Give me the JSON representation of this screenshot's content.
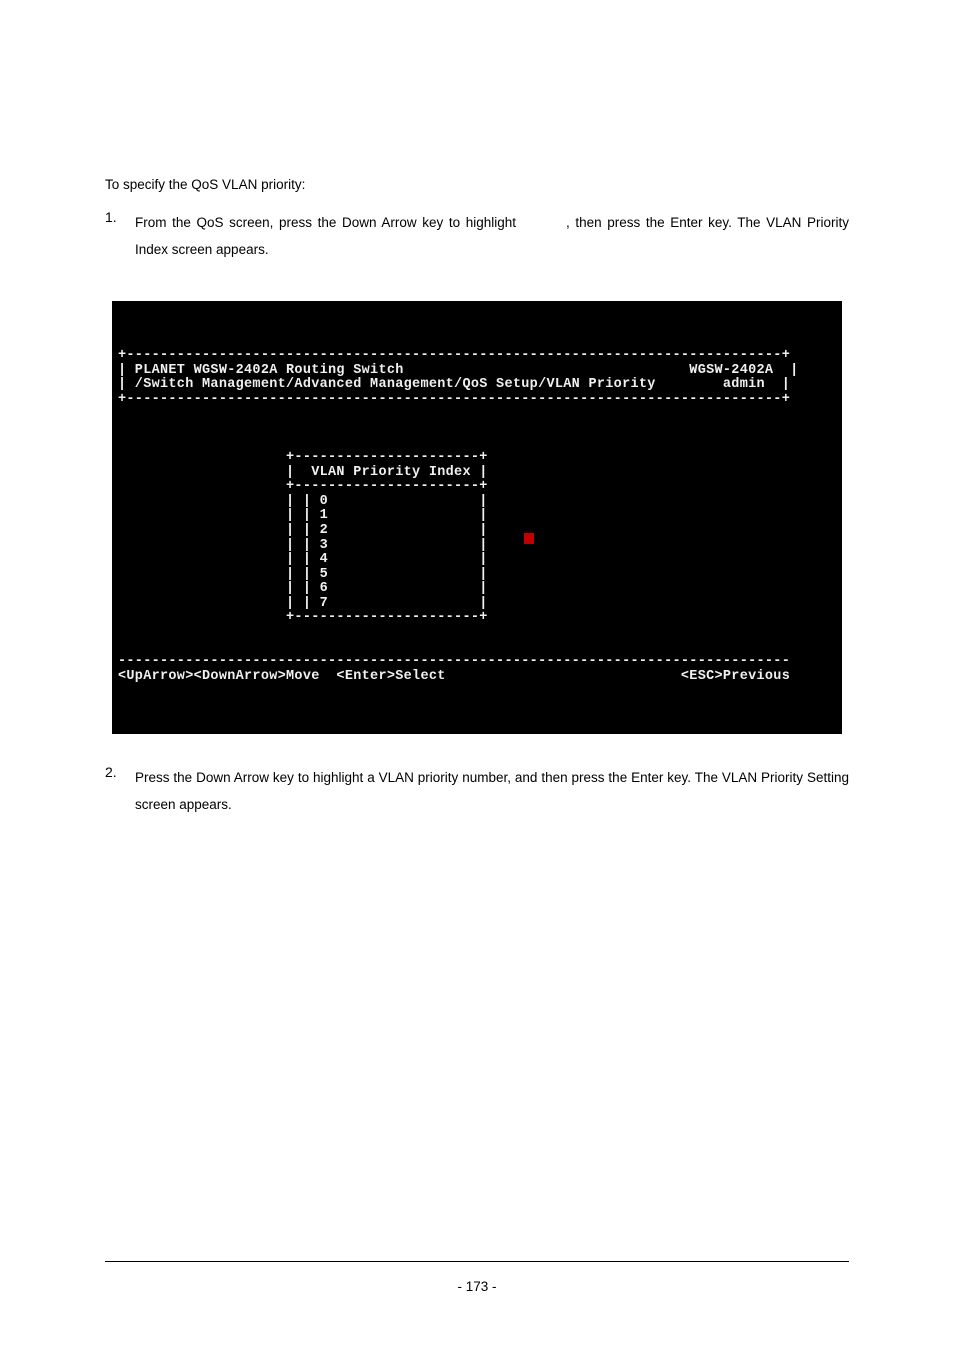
{
  "intro": "To specify the QoS VLAN priority:",
  "step1": {
    "number": "1.",
    "text_part1": "From the QoS screen, press the Down Arrow key to highlight",
    "text_part2": ", then press the Enter key. The VLAN Priority Index screen appears."
  },
  "terminal": {
    "title_line": "| PLANET WGSW-2402A Routing Switch                                  WGSW-2402A  |",
    "path_line": "| /Switch Management/Advanced Management/QoS Setup/VLAN Priority        admin  |",
    "box_header": "                    |  VLAN Priority Index |",
    "row0": "                    | | 0                  |",
    "row1": "                    | | 1                  |",
    "row2": "                    | | 2                  |",
    "row3": "                    | | 3                  |",
    "row4": "                    | | 4                  |",
    "row5": "                    | | 5                  |",
    "row6": "                    | | 6                  |",
    "row7": "                    | | 7                  |",
    "status_line": "<UpArrow><DownArrow>Move  <Enter>Select                            <ESC>Previous",
    "sep_top": "+------------------------------------------------------------------------------+",
    "sep_mid": "+------------------------------------------------------------------------------+",
    "sep_dashes": "--------------------------------------------------------------------------------",
    "box_top": "                    +----------------------+",
    "box_sep": "                    +----------------------+",
    "box_bottom": "                    +----------------------+"
  },
  "step2": {
    "number": "2.",
    "text": "Press the Down Arrow key to highlight a VLAN priority number, and then press the Enter key. The VLAN Priority Setting screen appears."
  },
  "footer": {
    "page": "- 173 -"
  }
}
